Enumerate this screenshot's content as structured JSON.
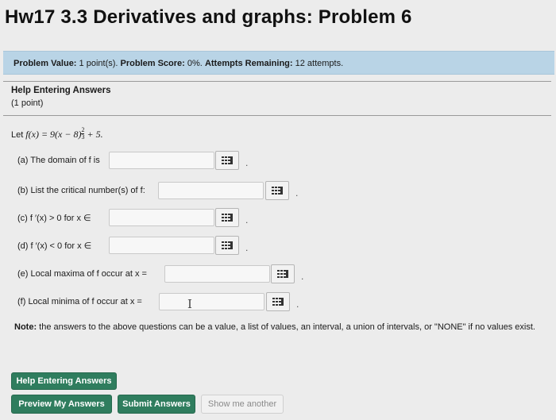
{
  "page": {
    "title": "Hw17 3.3 Derivatives and graphs: Problem 6"
  },
  "info_bar": {
    "problem_value_label": "Problem Value:",
    "problem_value": "1 point(s).",
    "problem_score_label": "Problem Score:",
    "problem_score": "0%.",
    "attempts_label": "Attempts Remaining:",
    "attempts": "12 attempts."
  },
  "help": {
    "title": "Help Entering Answers",
    "points": "(1 point)"
  },
  "problem": {
    "let_label": "Let",
    "function": "f(x) = 9(x − 8)",
    "exponent_num": "2",
    "exponent_den": "3",
    "tail": "+ 5."
  },
  "questions": [
    {
      "label": "(a) The domain of f is",
      "value": ""
    },
    {
      "label": "(b) List the critical number(s) of f:",
      "value": ""
    },
    {
      "label": "(c) f ′(x) > 0 for x ∈",
      "value": ""
    },
    {
      "label": "(d) f ′(x) < 0 for x ∈",
      "value": ""
    },
    {
      "label": "(e) Local maxima of f occur at x =",
      "value": ""
    },
    {
      "label": "(f) Local minima of f occur at x =",
      "value": ""
    }
  ],
  "note": {
    "label": "Note:",
    "text": "the answers to the above questions can be a value, a list of values, an interval, a union of intervals, or \"NONE\" if no values exist."
  },
  "buttons": {
    "help_entering": "Help Entering Answers",
    "preview": "Preview My Answers",
    "submit": "Submit Answers",
    "show_another": "Show me another"
  },
  "colors": {
    "info_bar_bg": "#b9d4e6",
    "button_green": "#2f7d5e"
  },
  "icons": {
    "palette": "equation-palette-icon",
    "text_cursor": "text-cursor-icon"
  }
}
